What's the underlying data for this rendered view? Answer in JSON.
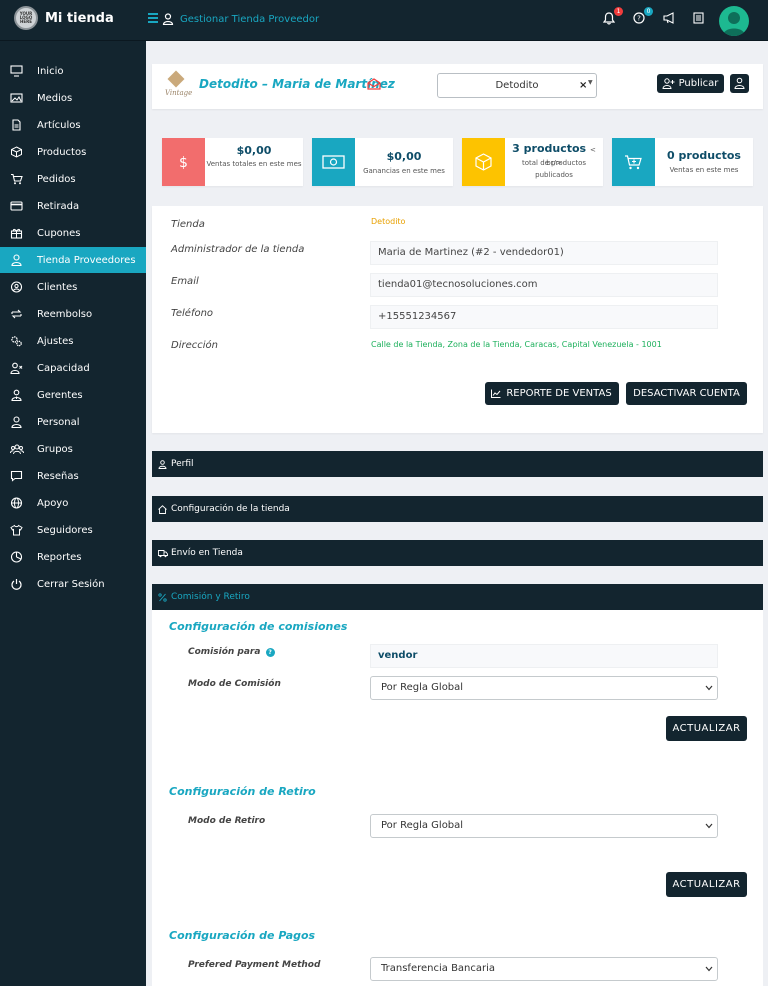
{
  "app": {
    "logo_text": "YOUR LOGO HERE",
    "name": "Mi tienda",
    "top_link": "Gestionar Tienda Proveedor",
    "notifications_count": "1",
    "help_count": "0",
    "colors": {
      "sidebar": "#13252f",
      "accent": "#19a7c1",
      "alert": "#f03c3c"
    }
  },
  "sidebar": {
    "items": [
      {
        "label": "Inicio",
        "icon": "monitor-icon"
      },
      {
        "label": "Medios",
        "icon": "image-icon"
      },
      {
        "label": "Artículos",
        "icon": "document-icon"
      },
      {
        "label": "Productos",
        "icon": "box-icon"
      },
      {
        "label": "Pedidos",
        "icon": "cart-icon"
      },
      {
        "label": "Retirada",
        "icon": "credit-card-icon"
      },
      {
        "label": "Cupones",
        "icon": "gift-icon"
      },
      {
        "label": "Tienda Proveedores",
        "icon": "user-icon",
        "active": true
      },
      {
        "label": "Clientes",
        "icon": "user-circle-icon"
      },
      {
        "label": "Reembolso",
        "icon": "refresh-icon"
      },
      {
        "label": "Ajustes",
        "icon": "gears-icon"
      },
      {
        "label": "Capacidad",
        "icon": "user-times-icon"
      },
      {
        "label": "Gerentes",
        "icon": "user-tie-icon"
      },
      {
        "label": "Personal",
        "icon": "user-outline-icon"
      },
      {
        "label": "Grupos",
        "icon": "users-icon"
      },
      {
        "label": "Reseñas",
        "icon": "comment-icon"
      },
      {
        "label": "Apoyo",
        "icon": "globe-icon"
      },
      {
        "label": "Seguidores",
        "icon": "tshirt-icon"
      },
      {
        "label": "Reportes",
        "icon": "pie-chart-icon"
      },
      {
        "label": "Cerrar Sesión",
        "icon": "power-icon"
      }
    ]
  },
  "store_header": {
    "logo_text": "Vintage",
    "title": "Detodito – Maria de Martínez",
    "select_value": "Detodito",
    "select_clear": "×",
    "publish_label": "Publicar"
  },
  "stats": [
    {
      "value": "$0,00",
      "label": "Ventas totales en este mes",
      "color": "#f26d6d",
      "icon": "dollar-icon"
    },
    {
      "value": "$0,00",
      "label": "Ganancias en este mes",
      "color": "#19a7c1",
      "icon": "money-icon"
    },
    {
      "value": "3 productos",
      "value_suffix": "< br/>",
      "label": "total de productos publicados",
      "color": "#fdc300",
      "icon": "cube-icon"
    },
    {
      "value": "0 productos",
      "label": "Ventas en este mes",
      "color": "#19a7c1",
      "icon": "cart-plus-icon"
    }
  ],
  "store_info": {
    "tienda_label": "Tienda",
    "tienda_value": "Detodito",
    "admin_label": "Administrador de la tienda",
    "admin_value": "Maria de Martinez (#2 - vendedor01)",
    "email_label": "Email",
    "email_value": "tienda01@tecnosoluciones.com",
    "phone_label": "Teléfono",
    "phone_value": "+15551234567",
    "address_label": "Dirección",
    "address_value": "Calle de la Tienda, Zona de la Tienda, Caracas, Capital Venezuela - 1001",
    "report_button": "REPORTE DE VENTAS",
    "deactivate_button": "DESACTIVAR CUENTA"
  },
  "accordion": {
    "perfil": "Perfil",
    "config_tienda": "Configuración de la tienda",
    "envio": "Envío en Tienda",
    "comision": "Comisión y Retiro"
  },
  "commission": {
    "title": "Configuración de comisiones",
    "for_label": "Comisión para",
    "for_value": "vendor",
    "mode_label": "Modo de Comisión",
    "mode_value": "Por Regla Global",
    "update_button": "ACTUALIZAR"
  },
  "withdrawal": {
    "title": "Configuración de Retiro",
    "mode_label": "Modo de Retiro",
    "mode_value": "Por Regla Global",
    "update_button": "ACTUALIZAR"
  },
  "payments": {
    "title": "Configuración de Pagos",
    "method_label": "Prefered Payment Method",
    "method_value": "Transferencia Bancaria"
  }
}
